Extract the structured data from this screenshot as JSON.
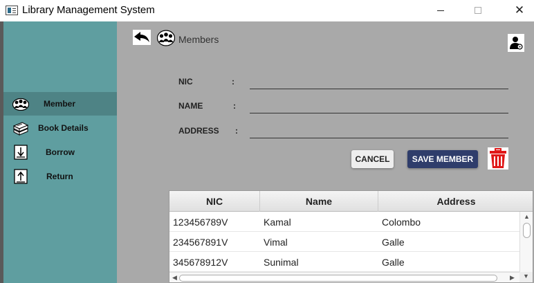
{
  "window": {
    "title": "Library Management System",
    "close_glyph": "✕"
  },
  "sidebar": {
    "items": [
      {
        "label": "Member",
        "icon": "members-icon",
        "active": true
      },
      {
        "label": "Book Details",
        "icon": "books-icon",
        "active": false
      },
      {
        "label": "Borrow",
        "icon": "borrow-icon",
        "active": false
      },
      {
        "label": "Return",
        "icon": "return-icon",
        "active": false
      }
    ]
  },
  "header": {
    "title": "Members"
  },
  "form": {
    "fields": [
      {
        "label": "NIC",
        "colon": ":",
        "value": ""
      },
      {
        "label": "NAME",
        "colon": ":",
        "value": ""
      },
      {
        "label": "ADDRESS",
        "colon": ":",
        "value": ""
      }
    ],
    "cancel_label": "CANCEL",
    "save_label": "SAVE MEMBER"
  },
  "table": {
    "columns": [
      "NIC",
      "Name",
      "Address"
    ],
    "rows": [
      [
        "123456789V",
        "Kamal",
        "Colombo"
      ],
      [
        "234567891V",
        "Vimal",
        "Galle"
      ],
      [
        "345678912V",
        "Sunimal",
        "Galle"
      ]
    ]
  },
  "colors": {
    "sidebar": "#5f9ea0",
    "sidebar_active": "#4e8385",
    "main": "#a9a9a9",
    "save_button": "#2f3d6b",
    "trash": "#e01818"
  }
}
